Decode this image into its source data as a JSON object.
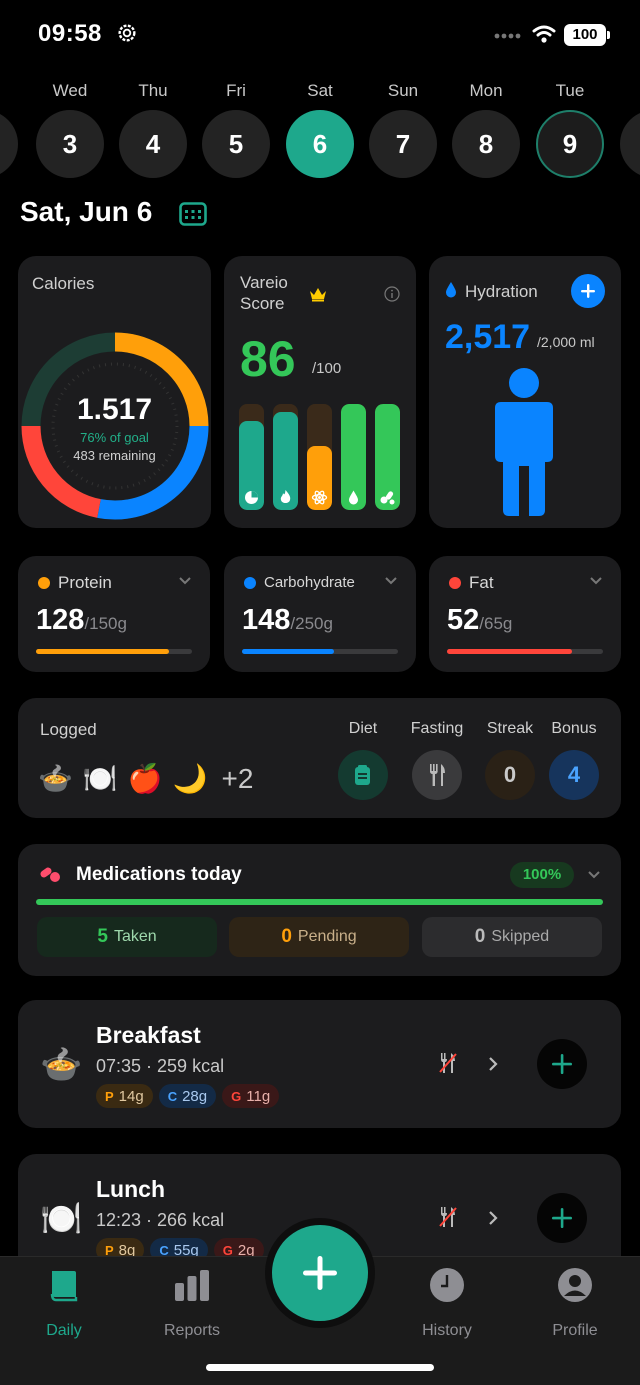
{
  "status": {
    "time": "09:58",
    "battery": "100"
  },
  "week": [
    {
      "name": "Wed",
      "num": "3"
    },
    {
      "name": "Thu",
      "num": "4"
    },
    {
      "name": "Fri",
      "num": "5"
    },
    {
      "name": "Sat",
      "num": "6"
    },
    {
      "name": "Sun",
      "num": "7"
    },
    {
      "name": "Mon",
      "num": "8"
    },
    {
      "name": "Tue",
      "num": "9"
    }
  ],
  "date_title": "Sat, Jun 6",
  "calories": {
    "label": "Calories",
    "value": "1.517",
    "goal_text": "76% of goal",
    "remaining_text": "483 remaining",
    "progress": 0.76
  },
  "vareio": {
    "label": "Vareio Score",
    "score": "86",
    "max": "/100",
    "bars": [
      {
        "level": 0.84,
        "color": "#1ea88c",
        "icon": "pie-icon"
      },
      {
        "level": 0.92,
        "color": "#1ea88c",
        "icon": "flame-icon"
      },
      {
        "level": 0.6,
        "color": "#ff9f0a",
        "icon": "atom-icon"
      },
      {
        "level": 1.0,
        "color": "#34c759",
        "icon": "drop-icon"
      },
      {
        "level": 1.0,
        "color": "#34c759",
        "icon": "pills-icon"
      }
    ]
  },
  "hydration": {
    "label": "Hydration",
    "value": "2,517",
    "goal": "/2,000 ml"
  },
  "macros": [
    {
      "label": "Protein",
      "value": "128",
      "goal": "/150g",
      "color": "#ff9f0a",
      "progress": 0.853
    },
    {
      "label": "Carbohydrate",
      "value": "148",
      "goal": "/250g",
      "color": "#0a84ff",
      "progress": 0.592
    },
    {
      "label": "Fat",
      "value": "52",
      "goal": "/65g",
      "color": "#ff453a",
      "progress": 0.8
    }
  ],
  "logged": {
    "label": "Logged",
    "items": [
      "🍲",
      "🍽️",
      "🍎",
      "🌙"
    ],
    "more": "+2",
    "stats": [
      {
        "label": "Diet",
        "value": "",
        "icon": "diet-icon"
      },
      {
        "label": "Fasting",
        "value": "",
        "icon": "fork-knife-icon"
      },
      {
        "label": "Streak",
        "value": "0"
      },
      {
        "label": "Bonus",
        "value": "4"
      }
    ]
  },
  "meds": {
    "title": "Medications today",
    "percent": "100%",
    "taken": {
      "n": "5",
      "label": "Taken"
    },
    "pending": {
      "n": "0",
      "label": "Pending"
    },
    "skipped": {
      "n": "0",
      "label": "Skipped"
    }
  },
  "meals": [
    {
      "name": "Breakfast",
      "time": "07:35 · 259 kcal",
      "icon": "🍲",
      "tags": [
        {
          "k": "P",
          "v": "14g"
        },
        {
          "k": "C",
          "v": "28g"
        },
        {
          "k": "G",
          "v": "11g"
        }
      ]
    },
    {
      "name": "Lunch",
      "time": "12:23 · 266 kcal",
      "icon": "🍽️",
      "tags": [
        {
          "k": "P",
          "v": "8g"
        },
        {
          "k": "C",
          "v": "55g"
        },
        {
          "k": "G",
          "v": "2g"
        }
      ]
    }
  ],
  "tabs": {
    "daily": "Daily",
    "reports": "Reports",
    "history": "History",
    "profile": "Profile"
  }
}
